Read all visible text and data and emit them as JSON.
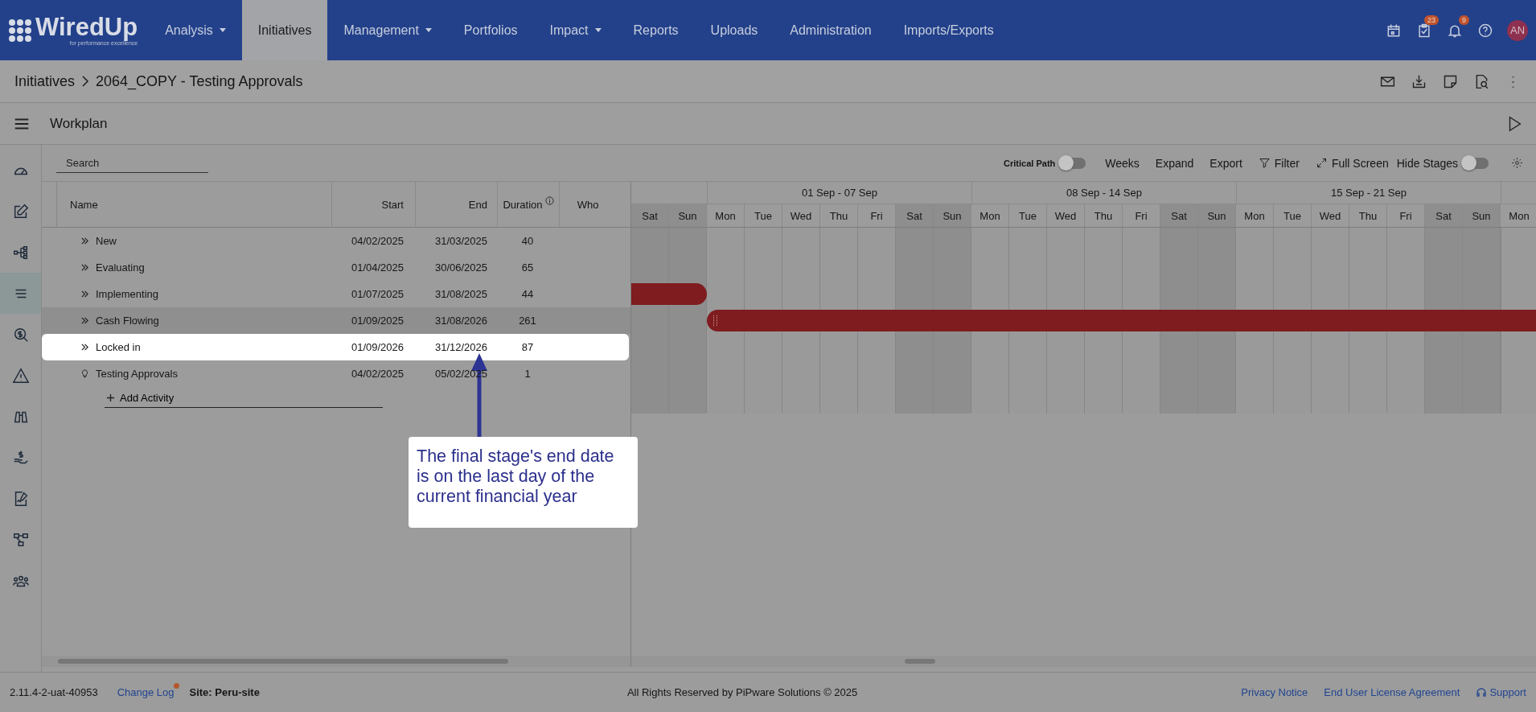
{
  "header": {
    "logo": {
      "name": "WiredUp",
      "tagline": "for performance excellence"
    },
    "nav": [
      {
        "label": "Analysis",
        "dropdown": true,
        "selected": false
      },
      {
        "label": "Initiatives",
        "dropdown": false,
        "selected": true
      },
      {
        "label": "Management",
        "dropdown": true,
        "selected": false
      },
      {
        "label": "Portfolios",
        "dropdown": false,
        "selected": false
      },
      {
        "label": "Impact",
        "dropdown": true,
        "selected": false
      },
      {
        "label": "Reports",
        "dropdown": false,
        "selected": false
      },
      {
        "label": "Uploads",
        "dropdown": false,
        "selected": false
      },
      {
        "label": "Administration",
        "dropdown": false,
        "selected": false
      },
      {
        "label": "Imports/Exports",
        "dropdown": false,
        "selected": false
      }
    ],
    "task_count": "23",
    "notification_count": "9",
    "avatar": "AN"
  },
  "breadcrumb": {
    "root": "Initiatives",
    "current": "2064_COPY - Testing Approvals"
  },
  "page_title": "Workplan",
  "sidebar": {
    "items": [
      {
        "selected": false
      },
      {
        "selected": false
      },
      {
        "selected": false
      },
      {
        "selected": true
      },
      {
        "selected": false
      },
      {
        "selected": false
      },
      {
        "selected": false
      },
      {
        "selected": false
      },
      {
        "selected": false
      },
      {
        "selected": false
      },
      {
        "selected": false
      }
    ]
  },
  "toolbar": {
    "search": {
      "placeholder": "Search"
    },
    "critical_path": {
      "label": "Critical Path",
      "on": false
    },
    "buttons": [
      {
        "kind": "text",
        "label": "Weeks"
      },
      {
        "kind": "text",
        "label": "Expand"
      },
      {
        "kind": "text",
        "label": "Export"
      },
      {
        "kind": "filter",
        "label": "Filter"
      },
      {
        "kind": "fullscreen",
        "label": "Full Screen"
      }
    ],
    "hide_stages": {
      "label": "Hide Stages",
      "on": false
    }
  },
  "table": {
    "columns": [
      "Name",
      "Start",
      "End",
      "Duration",
      "Who"
    ],
    "rows": [
      {
        "kind": "stage",
        "name": "New",
        "start": "04/02/2025",
        "end": "31/03/2025",
        "duration": "40",
        "highlighted": false,
        "hovered": false
      },
      {
        "kind": "stage",
        "name": "Evaluating",
        "start": "01/04/2025",
        "end": "30/06/2025",
        "duration": "65",
        "highlighted": false,
        "hovered": false
      },
      {
        "kind": "stage",
        "name": "Implementing",
        "start": "01/07/2025",
        "end": "31/08/2025",
        "duration": "44",
        "highlighted": false,
        "hovered": false
      },
      {
        "kind": "stage",
        "name": "Cash Flowing",
        "start": "01/09/2025",
        "end": "31/08/2026",
        "duration": "261",
        "highlighted": false,
        "hovered": true
      },
      {
        "kind": "stage",
        "name": "Locked in",
        "start": "01/09/2026",
        "end": "31/12/2026",
        "duration": "87",
        "highlighted": true,
        "hovered": false
      },
      {
        "kind": "milestone",
        "name": "Testing Approvals",
        "start": "04/02/2025",
        "end": "05/02/2025",
        "duration": "1",
        "highlighted": false,
        "hovered": false
      }
    ],
    "add_activity": "Add Activity"
  },
  "gantt": {
    "weeks": [
      "01 Sep - 07 Sep",
      "08 Sep - 14 Sep",
      "15 Sep - 21 Sep"
    ],
    "days": [
      {
        "label": "Sat",
        "weekend": true
      },
      {
        "label": "Sun",
        "weekend": true
      },
      {
        "label": "Mon",
        "weekend": false
      },
      {
        "label": "Tue",
        "weekend": false
      },
      {
        "label": "Wed",
        "weekend": false
      },
      {
        "label": "Thu",
        "weekend": false
      },
      {
        "label": "Fri",
        "weekend": false
      },
      {
        "label": "Sat",
        "weekend": true
      },
      {
        "label": "Sun",
        "weekend": true
      },
      {
        "label": "Mon",
        "weekend": false
      },
      {
        "label": "Tue",
        "weekend": false
      },
      {
        "label": "Wed",
        "weekend": false
      },
      {
        "label": "Thu",
        "weekend": false
      },
      {
        "label": "Fri",
        "weekend": false
      },
      {
        "label": "Sat",
        "weekend": true
      },
      {
        "label": "Sun",
        "weekend": true
      },
      {
        "label": "Mon",
        "weekend": false
      },
      {
        "label": "Tue",
        "weekend": false
      },
      {
        "label": "Wed",
        "weekend": false
      },
      {
        "label": "Thu",
        "weekend": false
      },
      {
        "label": "Fri",
        "weekend": false
      },
      {
        "label": "Sat",
        "weekend": true
      },
      {
        "label": "Sun",
        "weekend": true
      },
      {
        "label": "Mon",
        "weekend": false
      }
    ]
  },
  "callout": {
    "text": "The final stage's end date is on the last day of the current financial year"
  },
  "footer": {
    "version": "2.11.4-2-uat-40953",
    "change_log": "Change Log",
    "site": "Site: Peru-site",
    "copyright": "All Rights Reserved by PiPware Solutions © 2025",
    "links": [
      "Privacy Notice",
      "End User License Agreement"
    ],
    "support": "Support"
  }
}
